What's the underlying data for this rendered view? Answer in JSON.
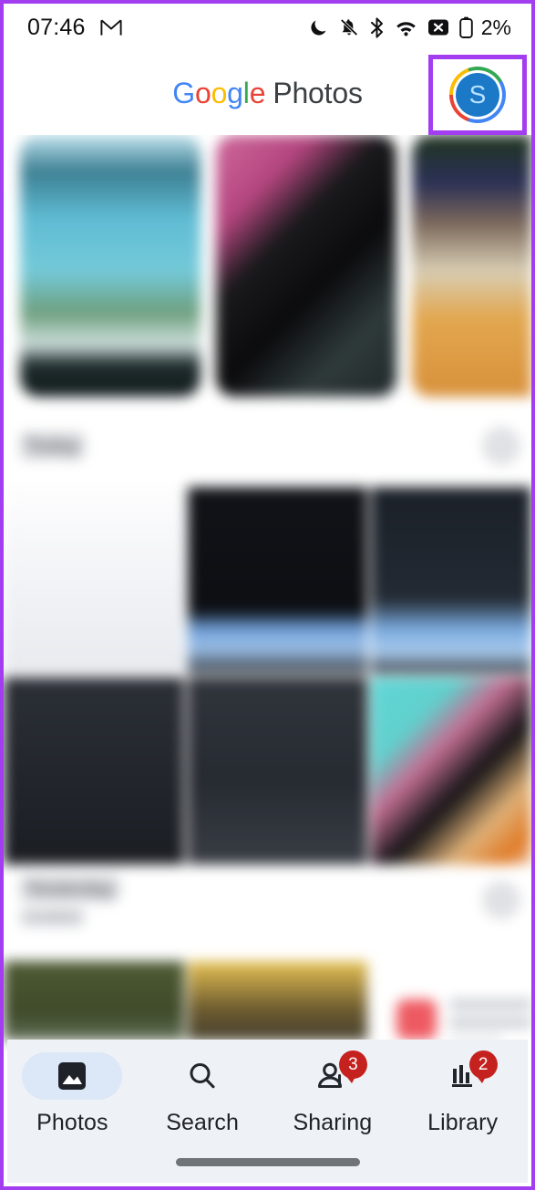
{
  "meta": {
    "highlight_color": "#a33ef0",
    "accent_blue": "#1b79c8",
    "badge_red": "#c5221f",
    "nav_background": "#eef1f5",
    "active_pill": "#dce7f8"
  },
  "status_bar": {
    "time": "07:46",
    "left_icons": [
      {
        "name": "gmail-icon",
        "label": "M"
      }
    ],
    "right_icons": [
      {
        "name": "do-not-disturb-moon-icon",
        "label": "Do not disturb"
      },
      {
        "name": "notifications-muted-icon",
        "label": "Ringer muted"
      },
      {
        "name": "bluetooth-icon",
        "label": "Bluetooth on"
      },
      {
        "name": "wifi-icon",
        "label": "Wi-Fi connected"
      },
      {
        "name": "no-sim-icon",
        "label": "No mobile signal"
      },
      {
        "name": "battery-icon",
        "label": "Battery"
      }
    ],
    "battery_percent": "2%"
  },
  "app_header": {
    "brand_word1": "Google",
    "brand_letters": [
      "G",
      "o",
      "o",
      "g",
      "l",
      "e"
    ],
    "brand_word2": "Photos",
    "avatar": {
      "name": "account-avatar",
      "initial": "S",
      "highlighted": true
    }
  },
  "content": {
    "memories": {
      "label": "Memories carousel",
      "cards": [
        {
          "name": "memory-card-1"
        },
        {
          "name": "memory-card-2"
        },
        {
          "name": "memory-card-3"
        }
      ]
    },
    "sections": [
      {
        "name": "photos-section-today",
        "title": "Today",
        "subtitle": "",
        "action_icon": "section-overflow-icon",
        "items": [
          {
            "name": "photo-thumbnail"
          },
          {
            "name": "photo-thumbnail"
          },
          {
            "name": "photo-thumbnail"
          },
          {
            "name": "photo-thumbnail"
          },
          {
            "name": "photo-thumbnail"
          },
          {
            "name": "photo-thumbnail"
          }
        ]
      },
      {
        "name": "photos-section-earlier",
        "title": "Yesterday",
        "subtitle": "Location",
        "action_icon": "section-overflow-icon",
        "items": [
          {
            "name": "photo-thumbnail"
          },
          {
            "name": "photo-thumbnail"
          },
          {
            "name": "photo-thumbnail"
          }
        ]
      }
    ]
  },
  "bottom_nav": {
    "items": [
      {
        "name": "nav-photos",
        "label": "Photos",
        "icon": "photo-library-icon",
        "active": true,
        "badge": ""
      },
      {
        "name": "nav-search",
        "label": "Search",
        "icon": "search-icon",
        "active": false,
        "badge": ""
      },
      {
        "name": "nav-sharing",
        "label": "Sharing",
        "icon": "sharing-person-icon",
        "active": false,
        "badge": "3"
      },
      {
        "name": "nav-library",
        "label": "Library",
        "icon": "library-bars-icon",
        "active": false,
        "badge": "2"
      }
    ],
    "home_indicator": "home-gesture-bar"
  }
}
